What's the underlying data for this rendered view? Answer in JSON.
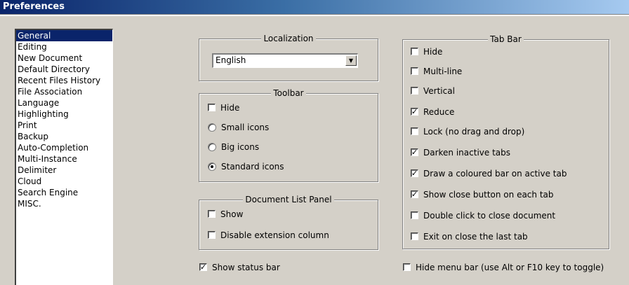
{
  "window": {
    "title": "Preferences"
  },
  "categories": [
    "General",
    "Editing",
    "New Document",
    "Default Directory",
    "Recent Files History",
    "File Association",
    "Language",
    "Highlighting",
    "Print",
    "Backup",
    "Auto-Completion",
    "Multi-Instance",
    "Delimiter",
    "Cloud",
    "Search Engine",
    "MISC."
  ],
  "selected_category": "General",
  "localization": {
    "title": "Localization",
    "selected": "English"
  },
  "toolbar": {
    "title": "Toolbar",
    "hide": {
      "label": "Hide",
      "checked": false
    },
    "small": {
      "label": "Small icons",
      "selected": false
    },
    "big": {
      "label": "Big icons",
      "selected": false
    },
    "standard": {
      "label": "Standard icons",
      "selected": true
    }
  },
  "doclist": {
    "title": "Document List Panel",
    "show": {
      "label": "Show",
      "checked": false
    },
    "disable_ext": {
      "label": "Disable extension column",
      "checked": false
    }
  },
  "tabbar": {
    "title": "Tab Bar",
    "hide": {
      "label": "Hide",
      "checked": false
    },
    "multiline": {
      "label": "Multi-line",
      "checked": false
    },
    "vertical": {
      "label": "Vertical",
      "checked": false
    },
    "reduce": {
      "label": "Reduce",
      "checked": true
    },
    "lock": {
      "label": "Lock (no drag and drop)",
      "checked": false
    },
    "darken": {
      "label": "Darken inactive tabs",
      "checked": true
    },
    "coloured": {
      "label": "Draw a coloured bar on active tab",
      "checked": true
    },
    "closebtn": {
      "label": "Show close button on each tab",
      "checked": true
    },
    "dblclick": {
      "label": "Double click to close document",
      "checked": false
    },
    "exitlast": {
      "label": "Exit on close the last tab",
      "checked": false
    }
  },
  "statusbar": {
    "label": "Show status bar",
    "checked": true
  },
  "menubar": {
    "label": "Hide menu bar (use Alt or F10 key to toggle)",
    "checked": false
  }
}
